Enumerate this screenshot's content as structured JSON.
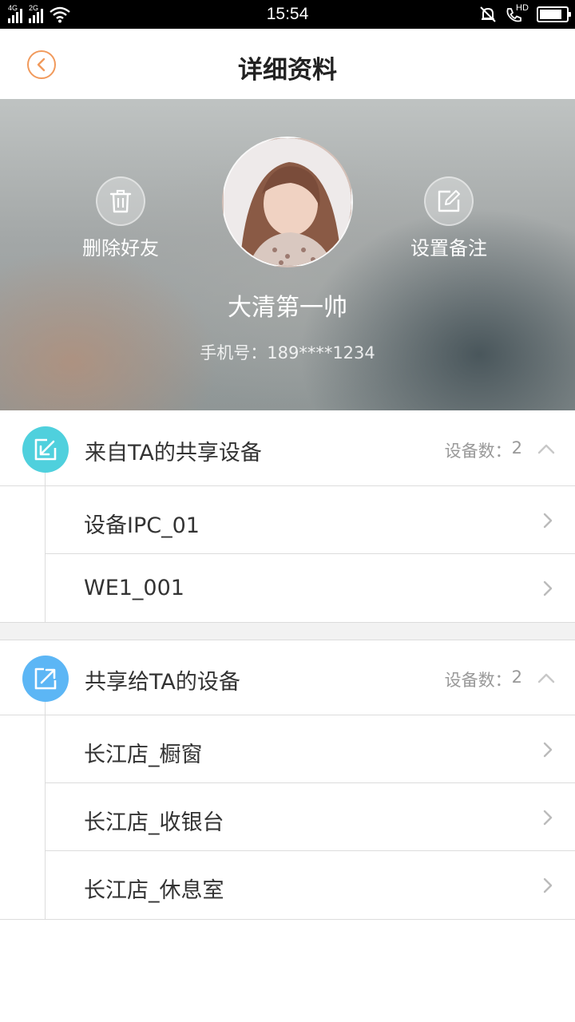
{
  "status_bar": {
    "network_1": "4G",
    "network_2": "2G",
    "time": "15:54",
    "hd_label": "HD",
    "battery_level": 0.85
  },
  "nav": {
    "title": "详细资料",
    "back_icon": "chevron-left-icon"
  },
  "profile": {
    "delete_label": "删除好友",
    "delete_icon": "trash-icon",
    "remark_label": "设置备注",
    "remark_icon": "edit-icon",
    "name": "大清第一帅",
    "phone": "手机号：189****1234"
  },
  "sections": [
    {
      "title": "来自TA的共享设备",
      "count_label": "设备数：",
      "count": "2",
      "icon": "import-icon",
      "icon_color": "#4fd0dd",
      "items": [
        "设备IPC_01",
        "WE1_001"
      ]
    },
    {
      "title": "共享给TA的设备",
      "count_label": "设备数：",
      "count": "2",
      "icon": "share-out-icon",
      "icon_color": "#5cb6f5",
      "items": [
        "长江店_橱窗",
        "长江店_收银台",
        "长江店_休息室"
      ]
    }
  ],
  "colors": {
    "accent_orange": "#f19a5c",
    "divider": "#dcdcdc"
  }
}
